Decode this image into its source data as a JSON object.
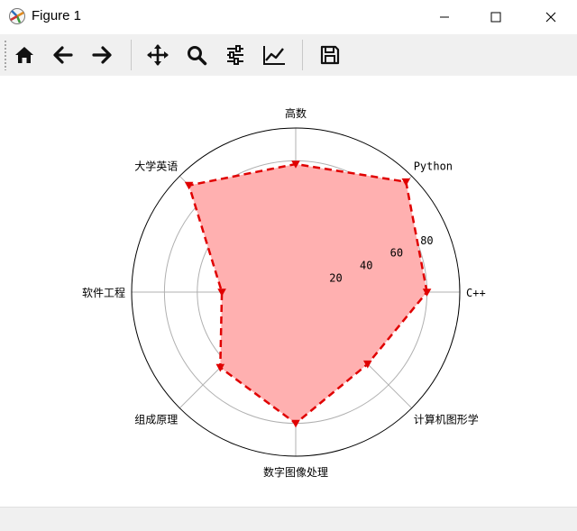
{
  "window": {
    "title": "Figure 1"
  },
  "toolbar": {
    "buttons": [
      {
        "name": "home-button",
        "icon": "home-icon"
      },
      {
        "name": "back-button",
        "icon": "arrow-left-icon"
      },
      {
        "name": "forward-button",
        "icon": "arrow-right-icon"
      },
      {
        "name": "pan-button",
        "icon": "move-icon"
      },
      {
        "name": "zoom-button",
        "icon": "magnifier-icon"
      },
      {
        "name": "configure-subplots-button",
        "icon": "sliders-icon"
      },
      {
        "name": "edit-axis-button",
        "icon": "line-chart-icon"
      },
      {
        "name": "save-button",
        "icon": "floppy-disk-icon"
      }
    ]
  },
  "chart_data": {
    "type": "radar",
    "categories": [
      "C++",
      "Python",
      "高数",
      "大学英语",
      "软件工程",
      "组成原理",
      "数字图像处理",
      "计算机图形学"
    ],
    "values": [
      80,
      95,
      78,
      92,
      45,
      65,
      80,
      62
    ],
    "rlim": [
      0,
      100
    ],
    "rticks": [
      "20",
      "40",
      "60",
      "80"
    ],
    "grid": true,
    "colors": {
      "fill": "#ffb0b0",
      "line": "#e00000",
      "grid": "#b0b0b0"
    }
  }
}
